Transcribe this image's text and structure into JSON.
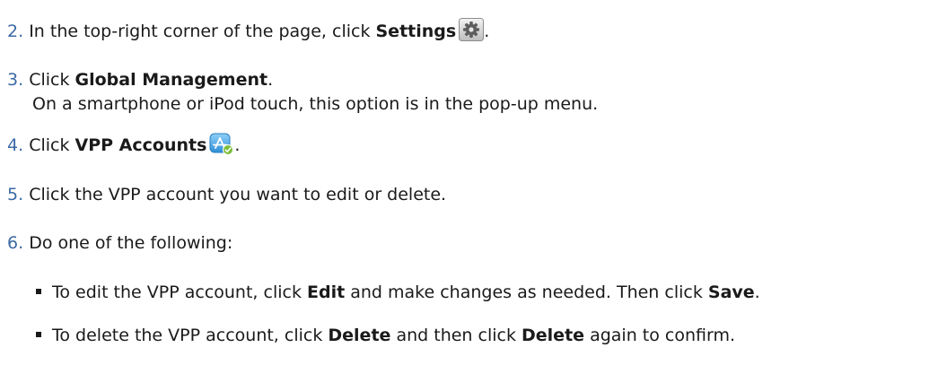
{
  "steps": [
    {
      "num": "2.",
      "pre": "In the top-right corner of the page, click ",
      "bold": "Settings",
      "post": ".",
      "icon": "gear-icon"
    },
    {
      "num": "3.",
      "pre": "Click ",
      "bold": "Global Management",
      "post": ".",
      "subline": "On a smartphone or iPod touch, this option is in the pop-up menu."
    },
    {
      "num": "4.",
      "pre": "Click ",
      "bold": "VPP Accounts",
      "post": ".",
      "icon": "vpp-app-store-icon"
    },
    {
      "num": "5.",
      "text": "Click the VPP account you want to edit or delete."
    },
    {
      "num": "6.",
      "text": "Do one of the following:",
      "bullets": [
        {
          "t1": "To edit the VPP account, click ",
          "b1": "Edit",
          "t2": " and make changes as needed. Then click ",
          "b2": "Save",
          "t3": "."
        },
        {
          "t1": "To delete the VPP account, click ",
          "b1": "Delete",
          "t2": " and then click ",
          "b2": "Delete",
          "t3": " again to confirm."
        }
      ]
    }
  ],
  "colors": {
    "step_number": "#3b6aa5",
    "text": "#1a1a1a"
  }
}
